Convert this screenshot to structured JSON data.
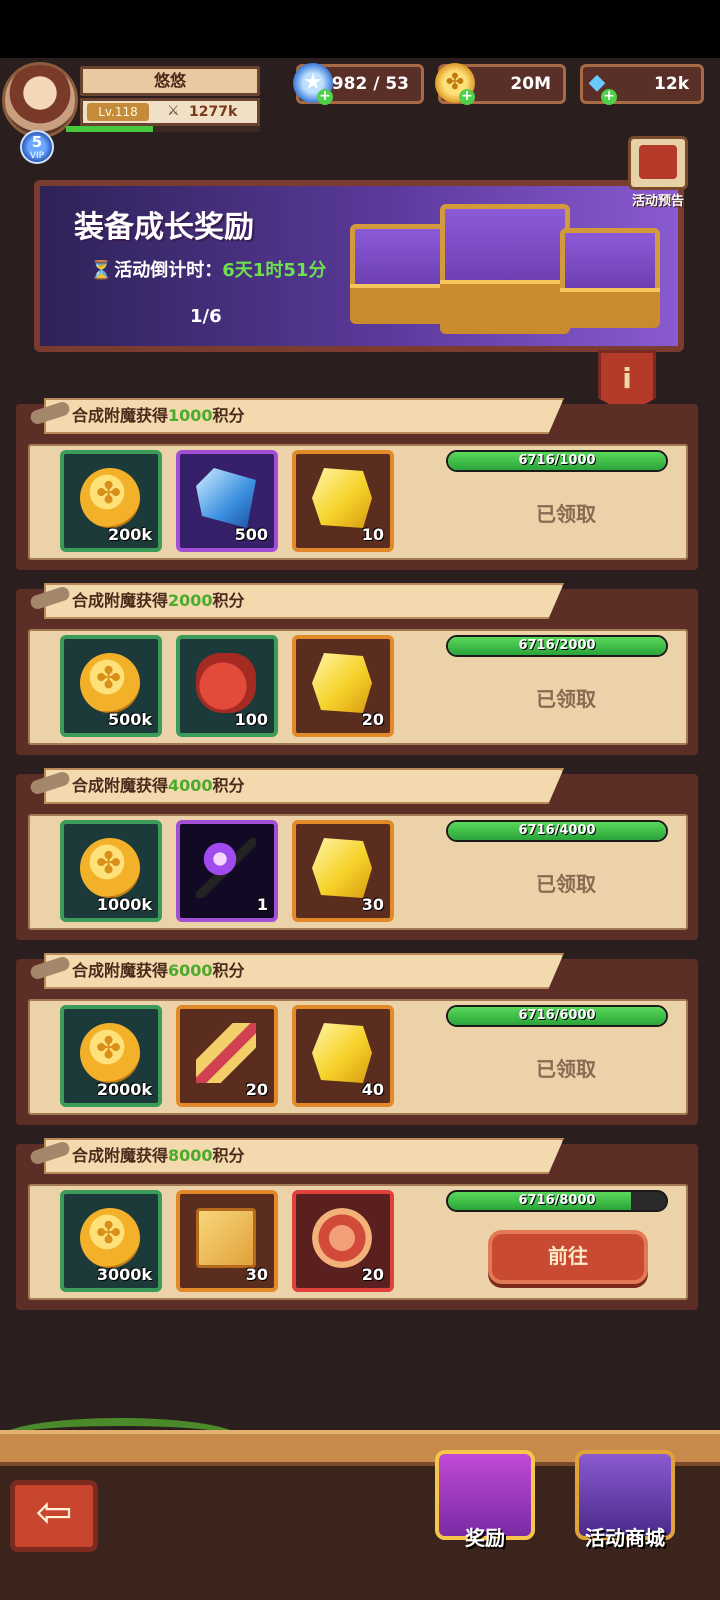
{
  "player": {
    "name": "悠悠",
    "level": "Lv.118",
    "power": "1277k",
    "vip_level": "5",
    "vip_label": "VIP"
  },
  "resources": [
    {
      "icon": "star-icon",
      "value": "982 / 53"
    },
    {
      "icon": "gold-coin-icon",
      "value": "20M"
    },
    {
      "icon": "diamond-icon",
      "value": "12k"
    }
  ],
  "banner": {
    "title": "装备成长奖励",
    "countdown_label": "活动倒计时：",
    "countdown_value": "6天1时51分",
    "pager": "1/6",
    "preview_label": "活动预告"
  },
  "tasks": [
    {
      "title_prefix": "合成附魔获得",
      "points": "1000",
      "title_suffix": "积分",
      "items": [
        {
          "icon": "gold-coin-icon",
          "qty": "200k"
        },
        {
          "icon": "blue-crystal-icon",
          "qty": "500"
        },
        {
          "icon": "gold-ore-icon",
          "qty": "10"
        }
      ],
      "progress_text": "6716/1000",
      "progress": 1.0,
      "action": "已领取",
      "claimed": true
    },
    {
      "title_prefix": "合成附魔获得",
      "points": "2000",
      "title_suffix": "积分",
      "items": [
        {
          "icon": "gold-coin-icon",
          "qty": "500k"
        },
        {
          "icon": "red-bag-icon",
          "qty": "100"
        },
        {
          "icon": "gold-ore-icon",
          "qty": "20"
        }
      ],
      "progress_text": "6716/2000",
      "progress": 1.0,
      "action": "已领取",
      "claimed": true
    },
    {
      "title_prefix": "合成附魔获得",
      "points": "4000",
      "title_suffix": "积分",
      "items": [
        {
          "icon": "gold-coin-icon",
          "qty": "1000k"
        },
        {
          "icon": "magic-staff-icon",
          "qty": "1"
        },
        {
          "icon": "gold-ore-icon",
          "qty": "30"
        }
      ],
      "progress_text": "6716/4000",
      "progress": 1.0,
      "action": "已领取",
      "claimed": true
    },
    {
      "title_prefix": "合成附魔获得",
      "points": "6000",
      "title_suffix": "积分",
      "items": [
        {
          "icon": "gold-coin-icon",
          "qty": "2000k"
        },
        {
          "icon": "scroll-icon",
          "qty": "20"
        },
        {
          "icon": "gold-ore-icon",
          "qty": "40"
        }
      ],
      "progress_text": "6716/6000",
      "progress": 1.0,
      "action": "已领取",
      "claimed": true
    },
    {
      "title_prefix": "合成附魔获得",
      "points": "8000",
      "title_suffix": "积分",
      "items": [
        {
          "icon": "gold-coin-icon",
          "qty": "3000k"
        },
        {
          "icon": "spell-book-icon",
          "qty": "30"
        },
        {
          "icon": "paw-medal-icon",
          "qty": "20"
        }
      ],
      "progress_text": "6716/8000",
      "progress": 0.84,
      "action": "前往",
      "claimed": false
    }
  ],
  "bottom_nav": {
    "rewards_label": "奖励",
    "shop_label": "活动商城"
  },
  "colors": {
    "points_green": "#4caa2c",
    "countdown_green": "#6ee04f",
    "progress_green": "#2aa43a"
  }
}
